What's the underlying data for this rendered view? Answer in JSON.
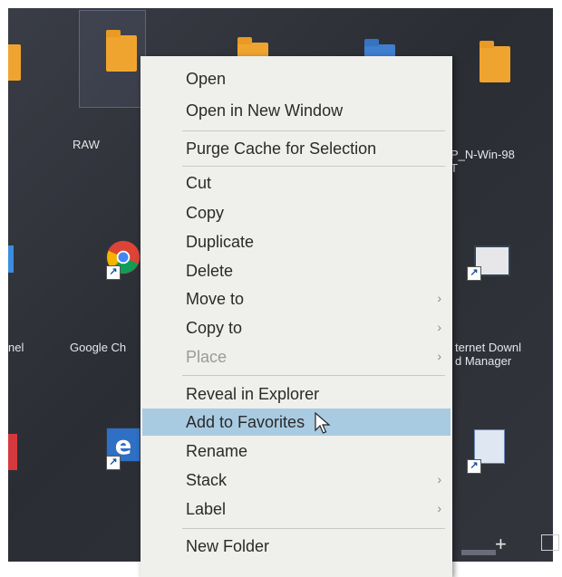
{
  "desktop": {
    "icons": [
      {
        "label": "RAW"
      },
      {
        "label": "P_N-Win-98\nT"
      },
      {
        "label": "nel"
      },
      {
        "label": "Google Ch"
      },
      {
        "label": "ternet Downl\nd Manager"
      }
    ]
  },
  "context_menu": {
    "items": [
      {
        "label": "Open",
        "has_submenu": false,
        "disabled": false
      },
      {
        "label": "Open in New Window",
        "has_submenu": false,
        "disabled": false
      },
      {
        "label": "Purge Cache for Selection",
        "has_submenu": false,
        "disabled": false
      },
      {
        "label": "Cut",
        "has_submenu": false,
        "disabled": false
      },
      {
        "label": "Copy",
        "has_submenu": false,
        "disabled": false
      },
      {
        "label": "Duplicate",
        "has_submenu": false,
        "disabled": false
      },
      {
        "label": "Delete",
        "has_submenu": false,
        "disabled": false
      },
      {
        "label": "Move to",
        "has_submenu": true,
        "disabled": false
      },
      {
        "label": "Copy to",
        "has_submenu": true,
        "disabled": false
      },
      {
        "label": "Place",
        "has_submenu": true,
        "disabled": true
      },
      {
        "label": "Reveal in Explorer",
        "has_submenu": false,
        "disabled": false
      },
      {
        "label": "Add to Favorites",
        "has_submenu": false,
        "disabled": false,
        "highlighted": true
      },
      {
        "label": "Rename",
        "has_submenu": false,
        "disabled": false
      },
      {
        "label": "Stack",
        "has_submenu": true,
        "disabled": false
      },
      {
        "label": "Label",
        "has_submenu": true,
        "disabled": false
      },
      {
        "label": "New Folder",
        "has_submenu": false,
        "disabled": false
      }
    ],
    "submenu_arrow": "›",
    "highlight_color": "#a9cbe2"
  },
  "taskbar": {
    "plus_glyph": "+"
  }
}
